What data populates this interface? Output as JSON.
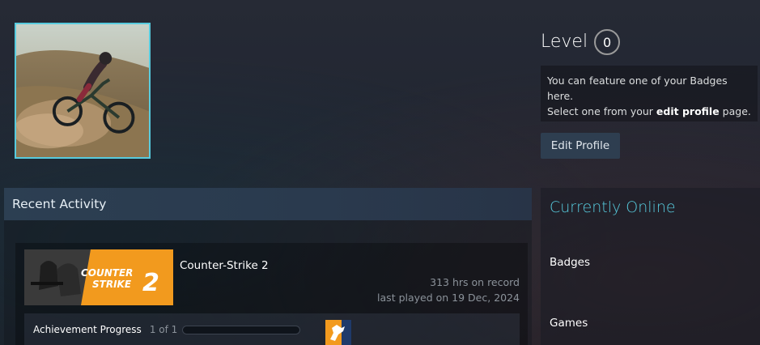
{
  "profile": {
    "avatar_alt": "avatar",
    "level_label": "Level",
    "level_value": "0",
    "badge_hint": {
      "line1": "You can feature one of your Badges here.",
      "line2_prefix": "Select one from your ",
      "line2_link": "edit profile",
      "line2_suffix": " page."
    },
    "edit_profile_label": "Edit Profile"
  },
  "recent_activity": {
    "header": "Recent Activity",
    "game": {
      "name": "Counter-Strike 2",
      "hours": "313 hrs on record",
      "last_played": "last played on 19 Dec, 2024",
      "capsule_text_line1": "COUNTER",
      "capsule_text_line2": "STRIKE",
      "capsule_text_num": "2",
      "achievement_label": "Achievement Progress",
      "achievement_count": "1 of 1",
      "achievement_progress": 0
    }
  },
  "sidebar": {
    "status": "Currently Online",
    "badges_label": "Badges",
    "games_label": "Games"
  },
  "colors": {
    "accent_online": "#57cbde",
    "cs2_orange": "#f29a1e"
  }
}
